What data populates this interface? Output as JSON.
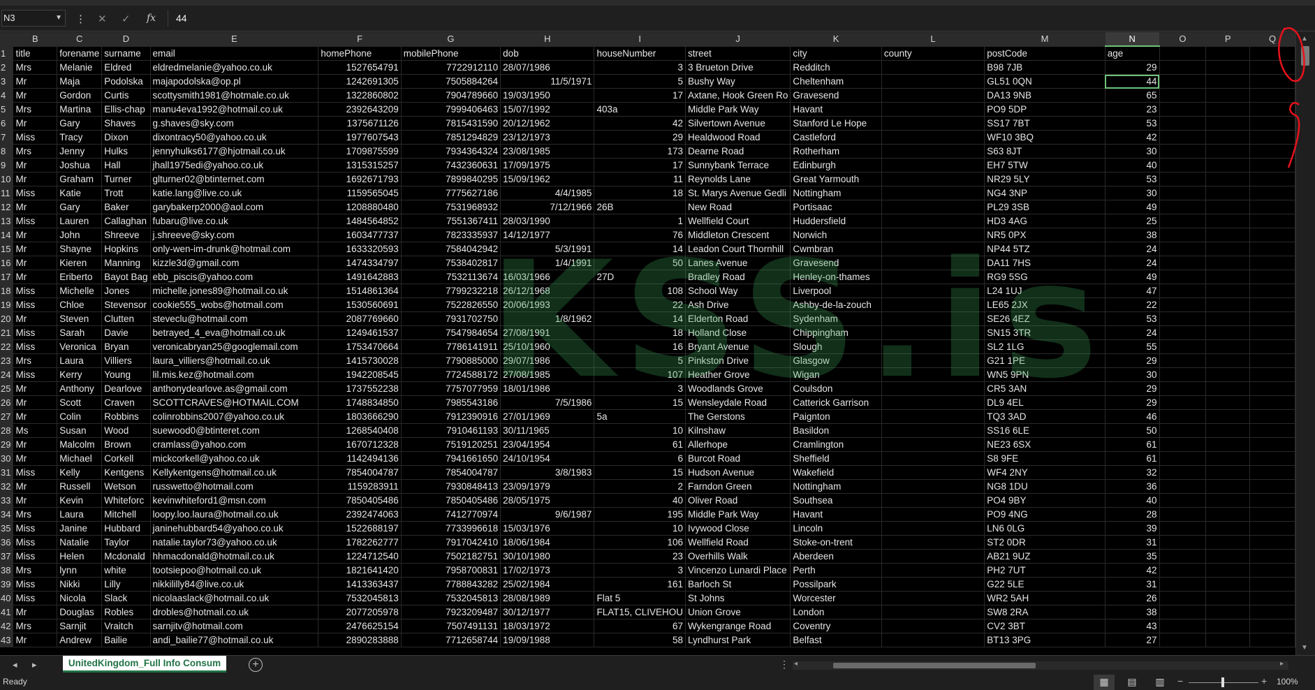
{
  "formula_bar": {
    "name_box": "N3",
    "value": "44"
  },
  "columns": [
    "B",
    "C",
    "D",
    "E",
    "F",
    "G",
    "H",
    "I",
    "J",
    "K",
    "L",
    "M",
    "N",
    "O",
    "P",
    "Q"
  ],
  "selected_column": "N",
  "headers": [
    "title",
    "forename",
    "surname",
    "email",
    "homePhone",
    "mobilePhone",
    "dob",
    "houseNumber",
    "street",
    "city",
    "county",
    "postCode",
    "age"
  ],
  "rows": [
    [
      "Mrs",
      "Melanie",
      "Eldred",
      "eldredmelanie@yahoo.co.uk",
      "1527654791",
      "7722912110",
      "28/07/1986",
      "3",
      "3 Brueton Drive",
      "Redditch",
      "",
      "B98 7JB",
      "29"
    ],
    [
      "Mr",
      "Maja",
      "Podolska",
      "majapodolska@op.pl",
      "1242691305",
      "7505884264",
      "11/5/1971",
      "5",
      "Bushy Way",
      "Cheltenham",
      "",
      "GL51 0QN",
      "44"
    ],
    [
      "Mr",
      "Gordon",
      "Curtis",
      "scottysmith1981@hotmale.co.uk",
      "1322860802",
      "7904789660",
      "19/03/1950",
      "17",
      "Axtane, Hook Green Ro",
      "Gravesend",
      "",
      "DA13 9NB",
      "65"
    ],
    [
      "Mrs",
      "Martina",
      "Ellis-chap",
      "manu4eva1992@hotmail.co.uk",
      "2392643209",
      "7999406463",
      "15/07/1992",
      "403a",
      "Middle Park Way",
      "Havant",
      "",
      "PO9 5DP",
      "23"
    ],
    [
      "Mr",
      "Gary",
      "Shaves",
      "g.shaves@sky.com",
      "1375671126",
      "7815431590",
      "20/12/1962",
      "42",
      "Silvertown Avenue",
      "Stanford Le Hope",
      "",
      "SS17 7BT",
      "53"
    ],
    [
      "Miss",
      "Tracy",
      "Dixon",
      "dixontracy50@yahoo.co.uk",
      "1977607543",
      "7851294829",
      "23/12/1973",
      "29",
      "Healdwood Road",
      "Castleford",
      "",
      "WF10 3BQ",
      "42"
    ],
    [
      "Mrs",
      "Jenny",
      "Hulks",
      "jennyhulks6177@hjotmail.co.uk",
      "1709875599",
      "7934364324",
      "23/08/1985",
      "173",
      "Dearne Road",
      "Rotherham",
      "",
      "S63 8JT",
      "30"
    ],
    [
      "Mr",
      "Joshua",
      "Hall",
      "jhall1975edi@yahoo.co.uk",
      "1315315257",
      "7432360631",
      "17/09/1975",
      "17",
      "Sunnybank Terrace",
      "Edinburgh",
      "",
      "EH7 5TW",
      "40"
    ],
    [
      "Mr",
      "Graham",
      "Turner",
      "glturner02@btinternet.com",
      "1692671793",
      "7899840295",
      "15/09/1962",
      "11",
      "Reynolds Lane",
      "Great Yarmouth",
      "",
      "NR29 5LY",
      "53"
    ],
    [
      "Miss",
      "Katie",
      "Trott",
      "katie.lang@live.co.uk",
      "1159565045",
      "7775627186",
      "4/4/1985",
      "18",
      "St. Marys Avenue Gedli",
      "Nottingham",
      "",
      "NG4 3NP",
      "30"
    ],
    [
      "Mr",
      "Gary",
      "Baker",
      "garybakerp2000@aol.com",
      "1208880480",
      "7531968932",
      "7/12/1966",
      "26B",
      "New Road",
      "Portisaac",
      "",
      "PL29 3SB",
      "49"
    ],
    [
      "Miss",
      "Lauren",
      "Callaghan",
      "fubaru@live.co.uk",
      "1484564852",
      "7551367411",
      "28/03/1990",
      "1",
      "Wellfield Court",
      "Huddersfield",
      "",
      "HD3 4AG",
      "25"
    ],
    [
      "Mr",
      "John",
      "Shreeve",
      "j.shreeve@sky.com",
      "1603477737",
      "7823335937",
      "14/12/1977",
      "76",
      "Middleton Crescent",
      "Norwich",
      "",
      "NR5 0PX",
      "38"
    ],
    [
      "Mr",
      "Shayne",
      "Hopkins",
      "only-wen-im-drunk@hotmail.com",
      "1633320593",
      "7584042942",
      "5/3/1991",
      "14",
      "Leadon Court Thornhill",
      "Cwmbran",
      "",
      "NP44 5TZ",
      "24"
    ],
    [
      "Mr",
      "Kieren",
      "Manning",
      "kizzle3d@gmail.com",
      "1474334797",
      "7538402817",
      "1/4/1991",
      "50",
      "Lanes Avenue",
      "Gravesend",
      "",
      "DA11 7HS",
      "24"
    ],
    [
      "Mr",
      "Eriberto",
      "Bayot Bag",
      "ebb_piscis@yahoo.com",
      "1491642883",
      "7532113674",
      "16/03/1966",
      "27D",
      "Bradley Road",
      "Henley-on-thames",
      "",
      "RG9 5SG",
      "49"
    ],
    [
      "Miss",
      "Michelle",
      "Jones",
      "michelle.jones89@hotmail.co.uk",
      "1514861364",
      "7799232218",
      "26/12/1968",
      "108",
      "School Way",
      "Liverpool",
      "",
      "L24 1UJ",
      "47"
    ],
    [
      "Miss",
      "Chloe",
      "Stevensor",
      "cookie555_wobs@hotmail.com",
      "1530560691",
      "7522826550",
      "20/06/1993",
      "22",
      "Ash Drive",
      "Ashby-de-la-zouch",
      "",
      "LE65 2JX",
      "22"
    ],
    [
      "Mr",
      "Steven",
      "Clutten",
      "steveclu@hotmail.com",
      "2087769660",
      "7931702750",
      "1/8/1962",
      "14",
      "Elderton Road",
      "Sydenham",
      "",
      "SE26 4EZ",
      "53"
    ],
    [
      "Miss",
      "Sarah",
      "Davie",
      "betrayed_4_eva@hotmail.co.uk",
      "1249461537",
      "7547984654",
      "27/08/1991",
      "18",
      "Holland Close",
      "Chippingham",
      "",
      "SN15 3TR",
      "24"
    ],
    [
      "Miss",
      "Veronica",
      "Bryan",
      "veronicabryan25@googlemail.com",
      "1753470664",
      "7786141911",
      "25/10/1960",
      "16",
      "Bryant Avenue",
      "Slough",
      "",
      "SL2 1LG",
      "55"
    ],
    [
      "Mrs",
      "Laura",
      "Villiers",
      "laura_villiers@hotmail.co.uk",
      "1415730028",
      "7790885000",
      "29/07/1986",
      "5",
      "Pinkston Drive",
      "Glasgow",
      "",
      "G21 1PE",
      "29"
    ],
    [
      "Miss",
      "Kerry",
      "Young",
      "lil.mis.kez@hotmail.com",
      "1942208545",
      "7724588172",
      "27/08/1985",
      "107",
      "Heather Grove",
      "Wigan",
      "",
      "WN5 9PN",
      "30"
    ],
    [
      "Mr",
      "Anthony",
      "Dearlove",
      "anthonydearlove.as@gmail.com",
      "1737552238",
      "7757077959",
      "18/01/1986",
      "3",
      "Woodlands Grove",
      "Coulsdon",
      "",
      "CR5 3AN",
      "29"
    ],
    [
      "Mr",
      "Scott",
      "Craven",
      "SCOTTCRAVES@HOTMAIL.COM",
      "1748834850",
      "7985543186",
      "7/5/1986",
      "15",
      "Wensleydale Road",
      "Catterick Garrison",
      "",
      "DL9 4EL",
      "29"
    ],
    [
      "Mr",
      "Colin",
      "Robbins",
      "colinrobbins2007@yahoo.co.uk",
      "1803666290",
      "7912390916",
      "27/01/1969",
      "5a",
      "The Gerstons",
      "Paignton",
      "",
      "TQ3 3AD",
      "46"
    ],
    [
      "Ms",
      "Susan",
      "Wood",
      "suewood0@btinteret.com",
      "1268540408",
      "7910461193",
      "30/11/1965",
      "10",
      "Kilnshaw",
      "Basildon",
      "",
      "SS16 6LE",
      "50"
    ],
    [
      "Mr",
      "Malcolm",
      "Brown",
      "cramlass@yahoo.com",
      "1670712328",
      "7519120251",
      "23/04/1954",
      "61",
      "Allerhope",
      "Cramlington",
      "",
      "NE23 6SX",
      "61"
    ],
    [
      "Mr",
      "Michael",
      "Corkell",
      "mickcorkell@yahoo.co.uk",
      "1142494136",
      "7941661650",
      "24/10/1954",
      "6",
      "Burcot Road",
      "Sheffield",
      "",
      "S8 9FE",
      "61"
    ],
    [
      "Miss",
      "Kelly",
      "Kentgens",
      "Kellykentgens@hotmail.co.uk",
      "7854004787",
      "7854004787",
      "3/8/1983",
      "15",
      "Hudson Avenue",
      "Wakefield",
      "",
      "WF4 2NY",
      "32"
    ],
    [
      "Mr",
      "Russell",
      "Wetson",
      "russwetto@hotmail.com",
      "1159283911",
      "7930848413",
      "23/09/1979",
      "2",
      "Farndon Green",
      "Nottingham",
      "",
      "NG8 1DU",
      "36"
    ],
    [
      "Mr",
      "Kevin",
      "Whiteforc",
      "kevinwhiteford1@msn.com",
      "7850405486",
      "7850405486",
      "28/05/1975",
      "40",
      "Oliver Road",
      "Southsea",
      "",
      "PO4 9BY",
      "40"
    ],
    [
      "Mrs",
      "Laura",
      "Mitchell",
      "loopy.loo.laura@hotmail.co.uk",
      "2392474063",
      "7412770974",
      "9/6/1987",
      "195",
      "Middle Park Way",
      "Havant",
      "",
      "PO9 4NG",
      "28"
    ],
    [
      "Miss",
      "Janine",
      "Hubbard",
      "janinehubbard54@yahoo.co.uk",
      "1522688197",
      "7733996618",
      "15/03/1976",
      "10",
      "Ivywood Close",
      "Lincoln",
      "",
      "LN6 0LG",
      "39"
    ],
    [
      "Miss",
      "Natalie",
      "Taylor",
      "natalie.taylor73@yahoo.co.uk",
      "1782262777",
      "7917042410",
      "18/06/1984",
      "106",
      "Wellfield Road",
      "Stoke-on-trent",
      "",
      "ST2 0DR",
      "31"
    ],
    [
      "Miss",
      "Helen",
      "Mcdonald",
      "hhmacdonald@hotmail.co.uk",
      "1224712540",
      "7502182751",
      "30/10/1980",
      "23",
      "Overhills Walk",
      "Aberdeen",
      "",
      "AB21 9UZ",
      "35"
    ],
    [
      "Mrs",
      "lynn",
      "white",
      "tootsiepoo@hotmail.co.uk",
      "1821641420",
      "7958700831",
      "17/02/1973",
      "3",
      "Vincenzo Lunardi Place",
      "Perth",
      "",
      "PH2 7UT",
      "42"
    ],
    [
      "Miss",
      "Nikki",
      "Lilly",
      "nikkililly84@live.co.uk",
      "1413363437",
      "7788843282",
      "25/02/1984",
      "161",
      "Barloch St",
      "Possilpark",
      "",
      "G22 5LE",
      "31"
    ],
    [
      "Miss",
      "Nicola",
      "Slack",
      "nicolaaslack@hotmail.co.uk",
      "7532045813",
      "7532045813",
      "28/08/1989",
      "Flat 5",
      "St Johns",
      "Worcester",
      "",
      "WR2 5AH",
      "26"
    ],
    [
      "Mr",
      "Douglas",
      "Robles",
      "drobles@hotmail.co.uk",
      "2077205978",
      "7923209487",
      "30/12/1977",
      "FLAT15, CLIVEHOU",
      "Union Grove",
      "London",
      "",
      "SW8 2RA",
      "38"
    ],
    [
      "Mrs",
      "Sarnjit",
      "Vraitch",
      "sarnjitv@hotmail.com",
      "2476625154",
      "7507491131",
      "18/03/1972",
      "67",
      "Wykengrange Road",
      "Coventry",
      "",
      "CV2 3BT",
      "43"
    ],
    [
      "Mr",
      "Andrew",
      "Bailie",
      "andi_bailie77@hotmail.co.uk",
      "2890283888",
      "7712658744",
      "19/09/1988",
      "58",
      "Lyndhurst Park",
      "Belfast",
      "",
      "BT13 3PG",
      "27"
    ]
  ],
  "sheet_tab": "UnitedKingdom_Full Info Consum",
  "status": "Ready",
  "zoom": "100%",
  "watermark": "KSS.is",
  "colors": {
    "accent": "#217346",
    "selection": "#6ec27a",
    "annotation": "#e8121b"
  }
}
